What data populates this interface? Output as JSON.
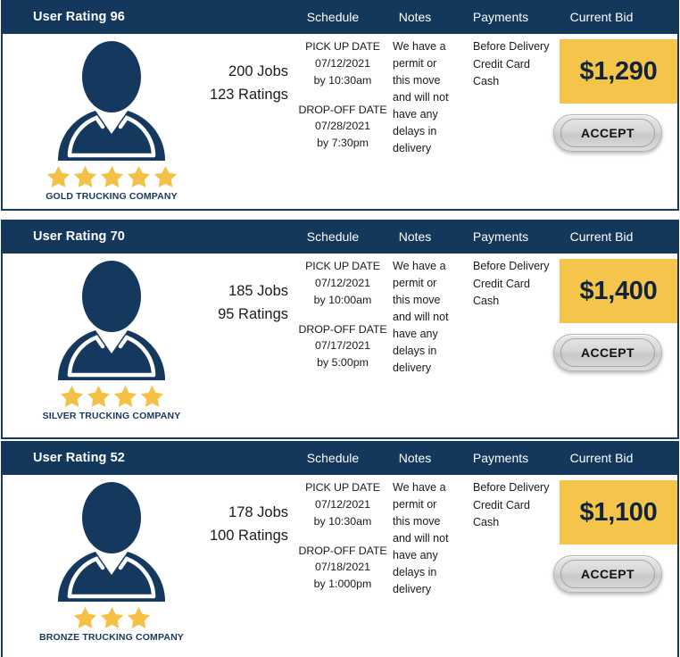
{
  "colors": {
    "navy": "#14385c",
    "navy_dark": "#12233b",
    "yellow": "#f5c54b",
    "star": "#f5c046",
    "white": "#ffffff",
    "text": "#1a1a1a"
  },
  "columns": {
    "schedule": "Schedule",
    "notes": "Notes",
    "payments": "Payments",
    "current_bid": "Current Bid"
  },
  "accept_label": "ACCEPT",
  "cards": [
    {
      "user_rating": "User Rating 96",
      "stars": 5,
      "company": "GOLD TRUCKING COMPANY",
      "jobs": "200 Jobs",
      "ratings": "123 Ratings",
      "pickup_label": "PICK UP DATE",
      "pickup_date": "07/12/2021",
      "pickup_time": "by 10:30am",
      "dropoff_label": "DROP-OFF DATE",
      "dropoff_date": "07/28/2021",
      "dropoff_time": "by 7:30pm",
      "notes": "We have a permit or this move and will not have any delays in delivery",
      "payments": [
        "Before Delivery",
        "Credit Card",
        "Cash"
      ],
      "bid": "$1,290"
    },
    {
      "user_rating": "User Rating 70",
      "stars": 4,
      "company": "SILVER TRUCKING COMPANY",
      "jobs": "185 Jobs",
      "ratings": "95 Ratings",
      "pickup_label": "PICK UP DATE",
      "pickup_date": "07/12/2021",
      "pickup_time": "by 10:00am",
      "dropoff_label": "DROP-OFF DATE",
      "dropoff_date": "07/17/2021",
      "dropoff_time": "by 5:00pm",
      "notes": "We have a permit or this move and will not have any delays in delivery",
      "payments": [
        "Before Delivery",
        "Credit Card",
        "Cash"
      ],
      "bid": "$1,400"
    },
    {
      "user_rating": "User Rating 52",
      "stars": 3,
      "company": "BRONZE TRUCKING COMPANY",
      "jobs": "178 Jobs",
      "ratings": "100 Ratings",
      "pickup_label": "PICK UP DATE",
      "pickup_date": "07/12/2021",
      "pickup_time": "by 10:30am",
      "dropoff_label": "DROP-OFF DATE",
      "dropoff_date": "07/18/2021",
      "dropoff_time": "by 1:000pm",
      "notes": "We have a permit or this move and will not have any delays in delivery",
      "payments": [
        "Before Delivery",
        "Credit Card",
        "Cash"
      ],
      "bid": "$1,100"
    }
  ]
}
